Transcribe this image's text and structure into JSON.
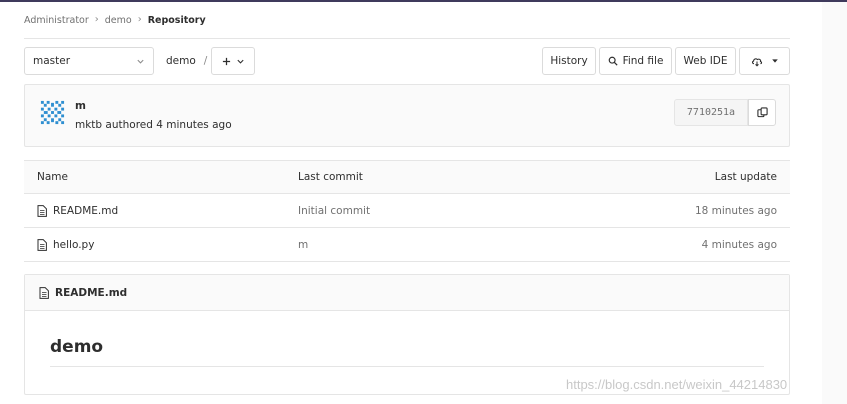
{
  "breadcrumb": {
    "items": [
      "Administrator",
      "demo"
    ],
    "current": "Repository"
  },
  "toolbar": {
    "branch": "master",
    "path_root": "demo",
    "path_separator": "/",
    "history_label": "History",
    "find_file_label": "Find file",
    "web_ide_label": "Web IDE"
  },
  "commit": {
    "title": "m",
    "meta": "mktb authored 4 minutes ago",
    "sha": "7710251a"
  },
  "table": {
    "headers": {
      "name": "Name",
      "last_commit": "Last commit",
      "last_update": "Last update"
    },
    "rows": [
      {
        "name": "README.md",
        "last_commit": "Initial commit",
        "last_update": "18 minutes ago"
      },
      {
        "name": "hello.py",
        "last_commit": "m",
        "last_update": "4 minutes ago"
      }
    ]
  },
  "readme": {
    "filename": "README.md",
    "heading": "demo"
  },
  "watermark": "https://blog.csdn.net/weixin_44214830",
  "colors": {
    "accent_bar": "#3f3a5c",
    "avatar": "#2f8fd1",
    "border": "#e5e5e5"
  },
  "icons": [
    "chevron-down-icon",
    "plus-icon",
    "search-icon",
    "cloud-download-icon",
    "copy-icon",
    "file-icon",
    "avatar-pattern-icon"
  ]
}
